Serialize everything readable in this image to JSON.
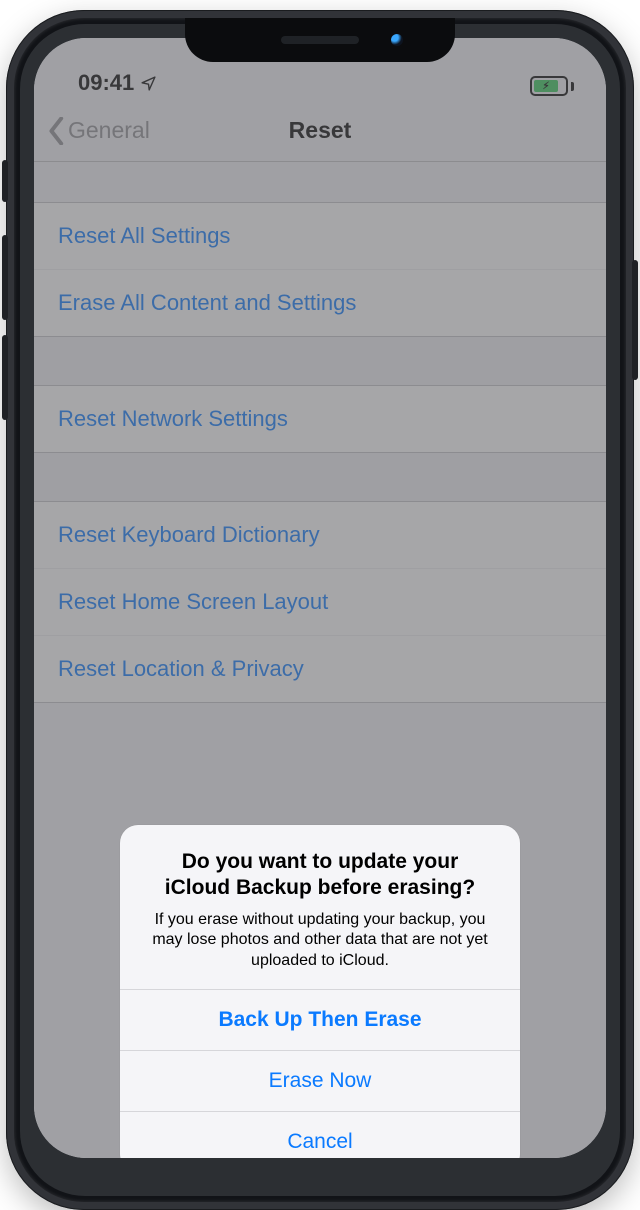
{
  "status": {
    "time": "09:41",
    "location_icon": "location-arrow",
    "charging": true
  },
  "nav": {
    "back_label": "General",
    "title": "Reset"
  },
  "groups": [
    {
      "rows": [
        {
          "label": "Reset All Settings"
        },
        {
          "label": "Erase All Content and Settings"
        }
      ]
    },
    {
      "rows": [
        {
          "label": "Reset Network Settings"
        }
      ]
    },
    {
      "rows": [
        {
          "label": "Reset Keyboard Dictionary"
        },
        {
          "label": "Reset Home Screen Layout"
        },
        {
          "label": "Reset Location & Privacy"
        }
      ]
    }
  ],
  "alert": {
    "title": "Do you want to update your iCloud Backup before erasing?",
    "body": "If you erase without updating your backup, you may lose photos and other data that are not yet uploaded to iCloud.",
    "buttons": {
      "backup": "Back Up Then Erase",
      "erase": "Erase Now",
      "cancel": "Cancel"
    }
  },
  "colors": {
    "accent": "#0a7aff",
    "battery_fill": "#34c759"
  }
}
